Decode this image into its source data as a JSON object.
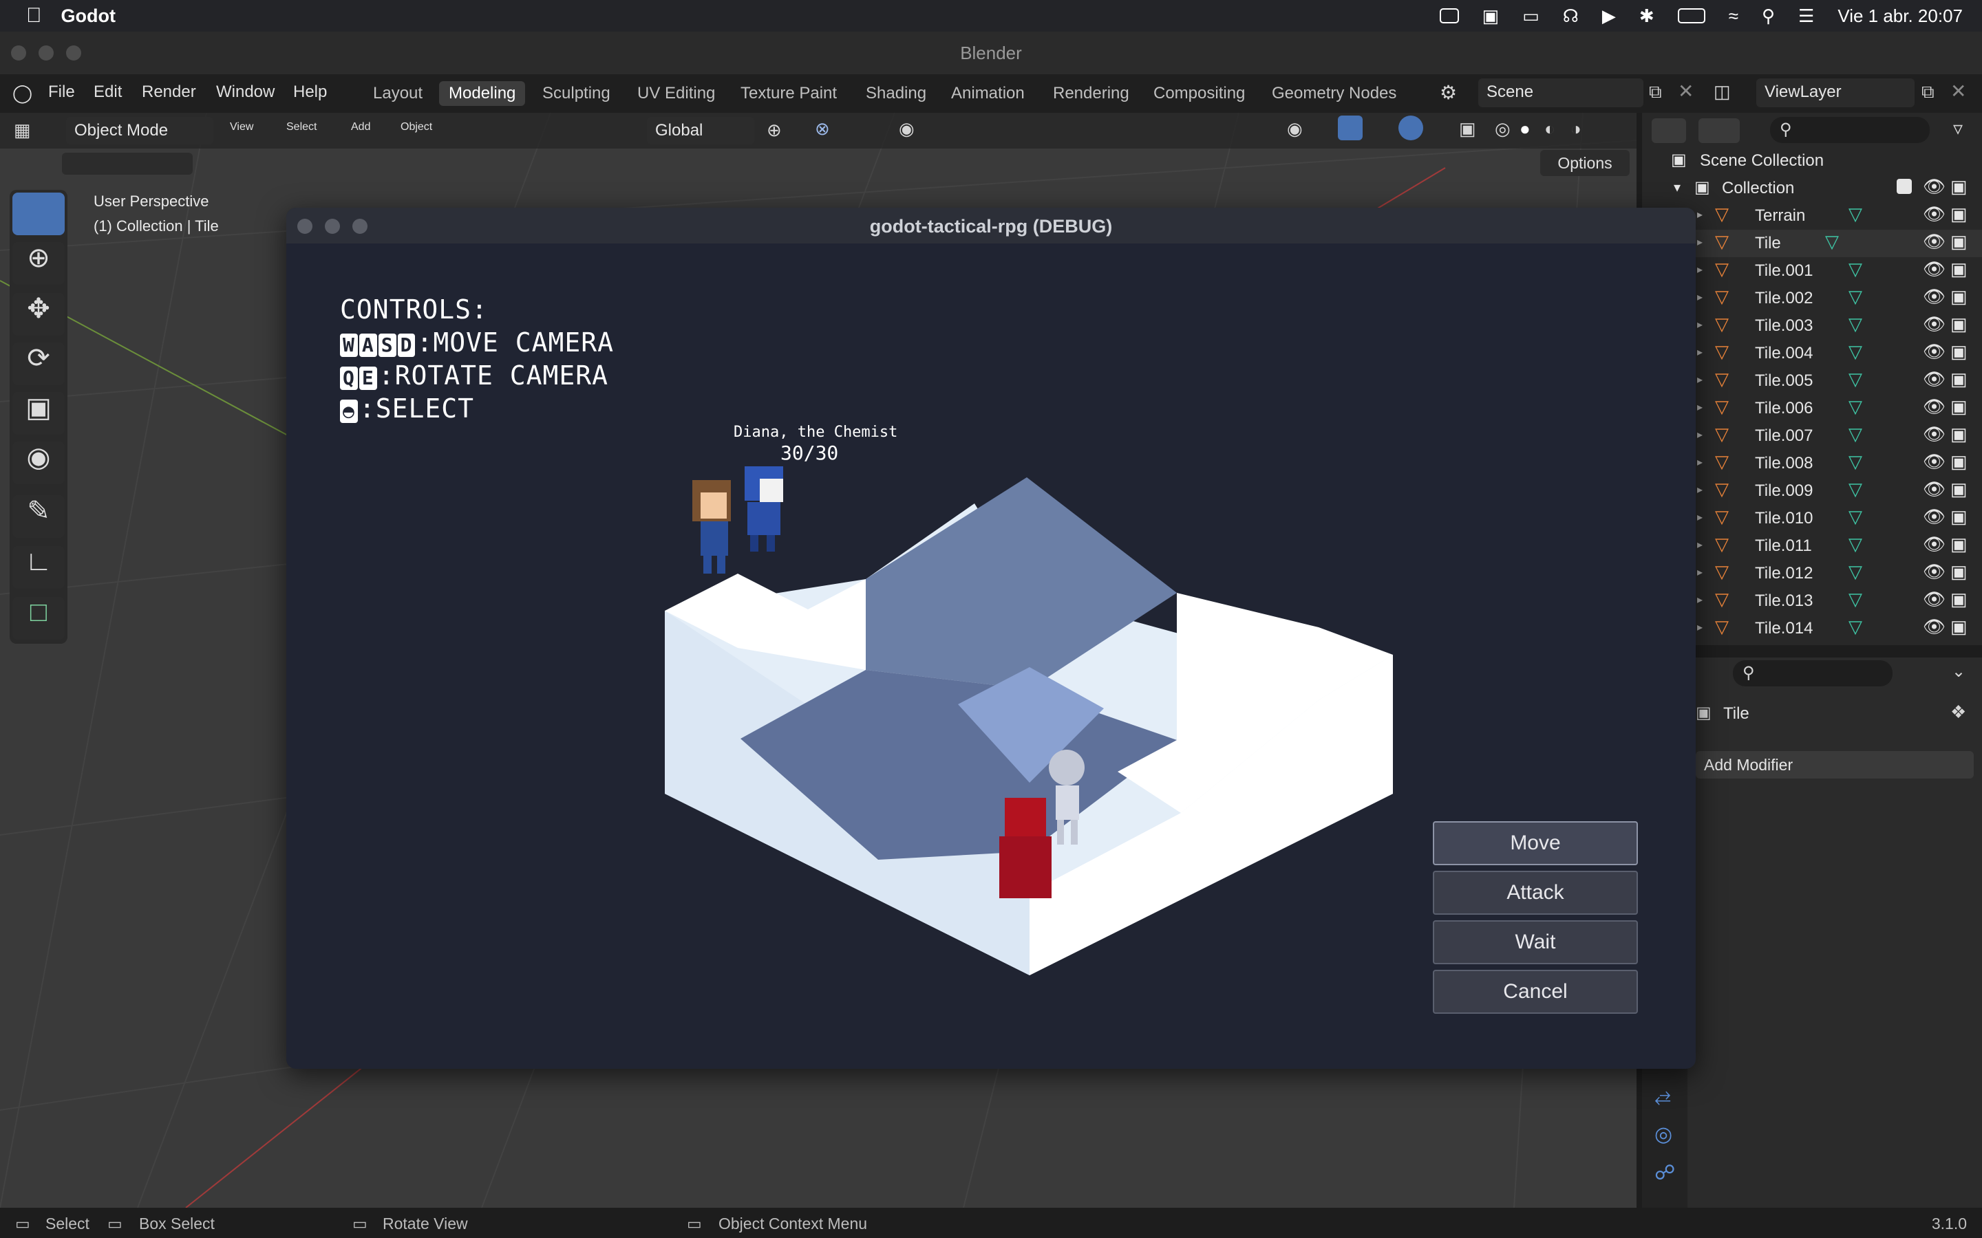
{
  "menubar": {
    "app_name": "Godot",
    "clock": "Vie 1 abr. 20:07"
  },
  "blender": {
    "window_title": "Blender",
    "menu": [
      "File",
      "Edit",
      "Render",
      "Window",
      "Help"
    ],
    "workspaces": [
      "Layout",
      "Modeling",
      "Sculpting",
      "UV Editing",
      "Texture Paint",
      "Shading",
      "Animation",
      "Rendering",
      "Compositing",
      "Geometry Nodes"
    ],
    "active_workspace": "Modeling",
    "scene": "Scene",
    "view_layer": "ViewLayer",
    "mode": "Object Mode",
    "view_menu": [
      "View",
      "Select",
      "Add",
      "Object"
    ],
    "transform_orientation": "Global",
    "options_label": "Options",
    "viewport_info": {
      "line1": "User Perspective",
      "line2": "(1) Collection | Tile"
    },
    "outliner": {
      "scene_collection": "Scene Collection",
      "collection": "Collection",
      "items": [
        "Terrain",
        "Tile",
        "Tile.001",
        "Tile.002",
        "Tile.003",
        "Tile.004",
        "Tile.005",
        "Tile.006",
        "Tile.007",
        "Tile.008",
        "Tile.009",
        "Tile.010",
        "Tile.011",
        "Tile.012",
        "Tile.013",
        "Tile.014"
      ]
    },
    "properties": {
      "object_name": "Tile",
      "add_modifier": "Add Modifier"
    },
    "statusbar": {
      "select": "Select",
      "box_select": "Box Select",
      "rotate_view": "Rotate View",
      "context_menu": "Object Context Menu",
      "version": "3.1.0"
    }
  },
  "game": {
    "window_title": "godot-tactical-rpg (DEBUG)",
    "controls_title": "CONTROLS:",
    "controls": [
      {
        "keys": [
          "W",
          "A",
          "S",
          "D"
        ],
        "action": ":MOVE CAMERA"
      },
      {
        "keys": [
          "Q",
          "E"
        ],
        "action": ":ROTATE CAMERA"
      },
      {
        "keys": [
          "◓"
        ],
        "action": ":SELECT"
      }
    ],
    "unit_name": "Diana, the Chemist",
    "unit_hp": "30/30",
    "actions": [
      "Move",
      "Attack",
      "Wait",
      "Cancel"
    ]
  },
  "colors": {
    "accent": "#4772b3",
    "object_orange": "#e8833a",
    "mesh_green": "#3fc4a4",
    "godot_bg": "#202432"
  }
}
